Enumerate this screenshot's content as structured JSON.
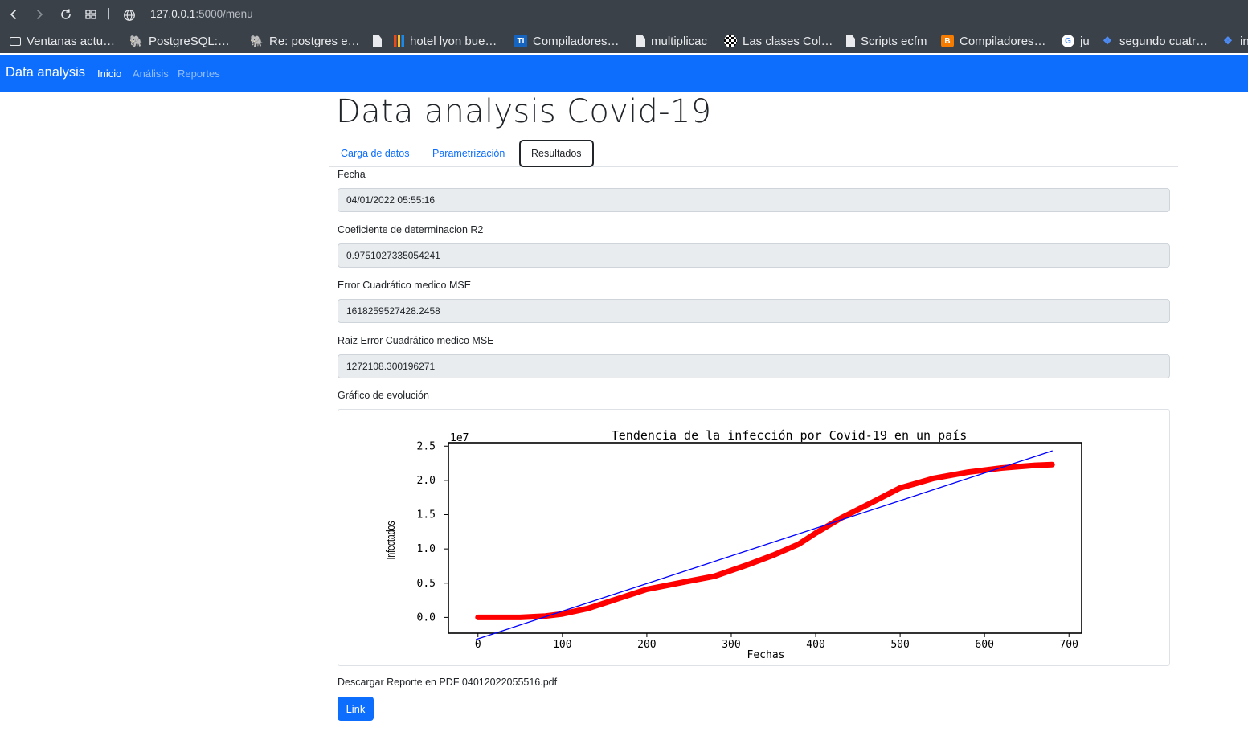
{
  "browser": {
    "url_host": "127.0.0.1",
    "url_path": ":5000/menu",
    "bookmarks": [
      {
        "label": "Ventanas actu…",
        "icon": "folder-icon"
      },
      {
        "label": "PostgreSQL:…",
        "icon": "postgres-icon"
      },
      {
        "label": "Re: postgres e…",
        "icon": "postgres-icon"
      },
      {
        "label": "",
        "icon": "document-icon"
      },
      {
        "label": "hotel lyon bue…",
        "icon": "bars-icon"
      },
      {
        "label": "Compiladores…",
        "icon": "ti-icon"
      },
      {
        "label": "multiplicac",
        "icon": "document-icon"
      },
      {
        "label": "Las clases Col…",
        "icon": "checker-icon"
      },
      {
        "label": "Scripts ecfm",
        "icon": "document-icon"
      },
      {
        "label": "Compiladores…",
        "icon": "blogger-icon"
      },
      {
        "label": "ju",
        "icon": "google-icon"
      },
      {
        "label": "segundo cuatr…",
        "icon": "dropbox-icon"
      },
      {
        "label": "in",
        "icon": "dropbox-icon"
      }
    ]
  },
  "navbar": {
    "brand": "Data analysis",
    "links": [
      {
        "label": "Inicio",
        "active": true
      },
      {
        "label": "Análisis",
        "active": false
      },
      {
        "label": "Reportes",
        "active": false
      }
    ],
    "color": "#0d6efd"
  },
  "main": {
    "title": "Data analysis Covid-19",
    "tabs": [
      {
        "label": "Carga de datos"
      },
      {
        "label": "Parametrización"
      },
      {
        "label": "Resultados",
        "active": true
      }
    ],
    "fields": [
      {
        "label": "Fecha",
        "value": "04/01/2022 05:55:16"
      },
      {
        "label": "Coeficiente de determinacion R2",
        "value": "0.9751027335054241"
      },
      {
        "label": "Error Cuadrático medico MSE",
        "value": "1618259527428.2458"
      },
      {
        "label": "Raiz Error Cuadrático medico MSE",
        "value": "1272108.300196271"
      }
    ],
    "chart_label": "Gráfico de evolución",
    "download_text": "Descargar Reporte en PDF 04012022055516.pdf",
    "link_label": "Link"
  },
  "chart_data": {
    "type": "line",
    "title": "Tendencia de la infección por Covid-19 en un país",
    "xlabel": "Fechas",
    "ylabel": "Infectados",
    "y_multiplier_label": "1e7",
    "xlim": [
      -35,
      715
    ],
    "ylim": [
      -0.23,
      2.55
    ],
    "x_ticks": [
      0,
      100,
      200,
      300,
      400,
      500,
      600,
      700
    ],
    "y_ticks": [
      0.0,
      0.5,
      1.0,
      1.5,
      2.0,
      2.5
    ],
    "y_tick_labels": [
      "0.0",
      "0.5",
      "1.0",
      "1.5",
      "2.0",
      "2.5"
    ],
    "grid": false,
    "series": [
      {
        "color": "#ff0000",
        "x": [
          0,
          50,
          80,
          100,
          130,
          160,
          200,
          250,
          280,
          320,
          350,
          380,
          400,
          430,
          470,
          500,
          540,
          580,
          620,
          660,
          680
        ],
        "y": [
          0.0,
          0.0,
          0.02,
          0.05,
          0.13,
          0.25,
          0.41,
          0.53,
          0.6,
          0.77,
          0.91,
          1.07,
          1.23,
          1.45,
          1.7,
          1.89,
          2.03,
          2.12,
          2.18,
          2.22,
          2.23
        ]
      },
      {
        "color": "#0000ff",
        "x": [
          -2,
          680
        ],
        "y": [
          -0.32,
          2.43
        ]
      }
    ]
  }
}
